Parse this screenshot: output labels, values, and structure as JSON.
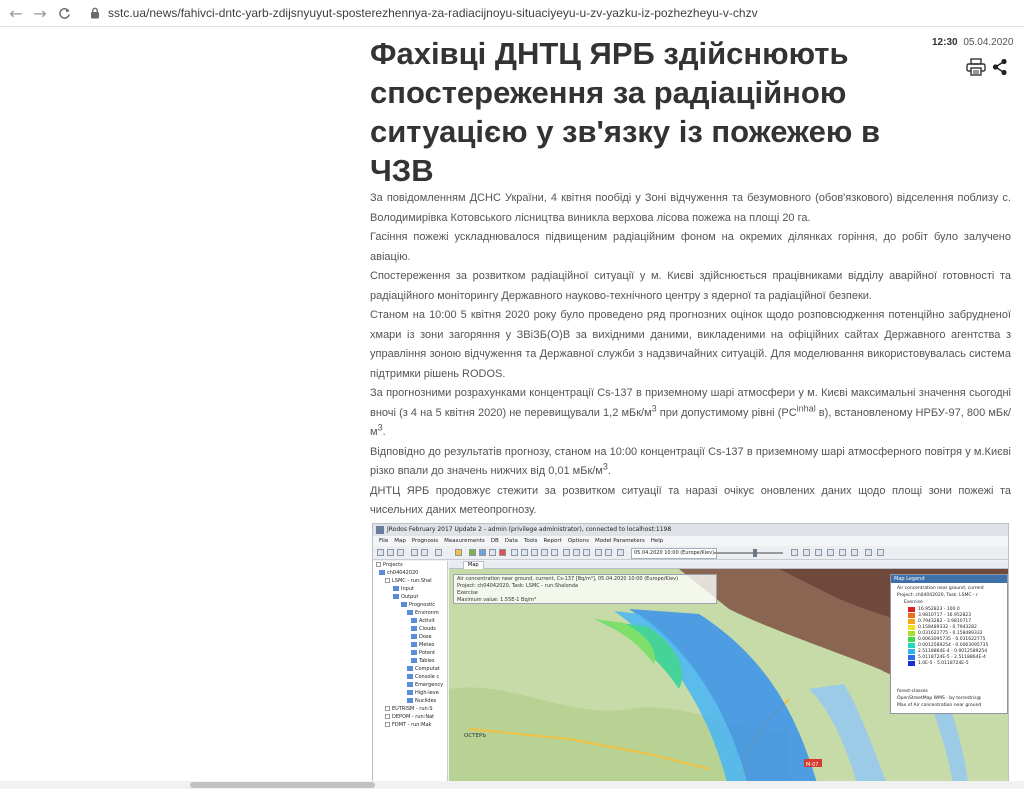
{
  "browser": {
    "url": "sstc.ua/news/fahivci-dntc-yarb-zdijsnyuyut-sposterezhennya-za-radiacijnoyu-situaciyeyu-u-zv-yazku-iz-pozhezheyu-v-chzv",
    "back_icon": "back-arrow-icon",
    "forward_icon": "forward-arrow-icon",
    "reload_icon": "reload-icon",
    "lock_icon": "lock-icon"
  },
  "article": {
    "title": "Фахівці ДНТЦ ЯРБ здійснюють спостереження за радіаційною ситуацією у зв'язку із пожежею в ЧЗВ",
    "time": "12:30",
    "date": "05.04.2020",
    "print_icon": "printer-icon",
    "share_icon": "share-icon",
    "paragraphs": {
      "p1": "За повідомленням ДСНС України, 4 квітня пообіді у Зоні відчуження та безумовного (обов'язкового) відселення поблизу с. Володимирівка Котовського лісництва виникла верхова лісова пожежа на площі 20 га.",
      "p2": "Гасіння пожежі ускладнювалося підвищеним радіаційним фоном на окремих ділянках горіння, до робіт було залучено авіацію.",
      "p3": "Спостереження за розвитком радіаційної ситуації у м. Києві здійснюється працівниками відділу аварійної готовності та радіаційного моніторингу Державного науково-технічного центру з ядерної та радіаційної безпеки.",
      "p4": "Станом на 10:00 5 квітня 2020 року було проведено ряд прогнозних оцінок щодо розповсюдження потенційно забрудненої хмари із зони загоряння у ЗВіЗБ(О)В за вихідними даними, викладеними на офіційних сайтах Державного агентства з управління зоною відчуження та Державної служби з надзвичайних ситуацій. Для моделювання використовувалась система підтримки рішень RODOS.",
      "p5a": "За прогнозними розрахунками концентрації Cs-137 в приземному шарі атмосфери у м. Києві максимальні значення сьогодні вночі (з 4 на 5 квітня 2020) не перевищували 1,2 мБк/м",
      "p5_sup1": "3",
      "p5b": " при допустимому рівні (PC",
      "p5_sup2": "inhal",
      "p5c": " в), встановленому НРБУ-97, 800 мБк/м",
      "p5_sup3": "3",
      "p5d": ".",
      "p6a": "Відповідно до результатів прогнозу, станом на 10:00 концентрації Cs-137 в приземному шарі атмосферного повітря у м.Києві різко впали до значень нижчих від 0,01 мБк/м",
      "p6_sup": "3",
      "p6b": ".",
      "p7": "ДНТЦ ЯРБ продовжує стежити за розвитком ситуації та наразі очікує оновлених даних щодо площі зони пожежі та чисельних даних метеопрогнозу."
    }
  },
  "rodos": {
    "window_title": "JRodos February 2017 Update 2 - admin (privilege administrator), connected to localhost:1198",
    "menu": [
      "File",
      "Map",
      "Prognosis",
      "Measurements",
      "DB",
      "Data",
      "Tools",
      "Report",
      "Options",
      "Model Parameters",
      "Help"
    ],
    "toolbar_date": "05.04.2020 10:00 (Europe/Kiev)",
    "map_tab": "Map",
    "tree": {
      "projects": "Projects",
      "project": "ch04042020",
      "lsmc": "LSMC - run:Shal",
      "input": "Input",
      "output": "Output",
      "prognosis": "Prognostic",
      "items": [
        "Environm",
        "Activit",
        "Clouds",
        "Dose",
        "Meteo",
        "Potent",
        "Tables"
      ],
      "computational": "Computat",
      "console": "Console c",
      "emergency": "Emergency",
      "highlevel": "High-leve",
      "nuclides": "Nuclides",
      "eutrism": "EUTRISM - run:S",
      "depom": "DEPOM - run:Nat",
      "fdmt": "FDMT - run:Mak"
    },
    "info": {
      "line1": "Air concentration near ground, current, Cs-137 [Bq/m³], 05.04.2020 10:00 (Europe/Kiev)",
      "line2": "Project: ch04042020, Task: LSMC - run:Shalonda",
      "line3": "Exercise",
      "line4": "Maximum value: 1.55E-1 Bq/m³"
    },
    "map_labels": {
      "road": "M-07",
      "town": "ОСТЕРЬ"
    },
    "legend": {
      "title": "Map Legend",
      "subtitle": "Air concentration near ground, current",
      "project": "Project: ch04042020, Task: LSMC - r",
      "exercise": "Exercise",
      "classes": [
        {
          "label": "16.952823 - 100.0",
          "color": "#e02020"
        },
        {
          "label": "3.9810717 - 16.952823",
          "color": "#f06a1a"
        },
        {
          "label": "0.7943282 - 3.9810717",
          "color": "#f4a51c"
        },
        {
          "label": "0.158489332 - 0.7943282",
          "color": "#f5dd22"
        },
        {
          "label": "0.031622775 - 0.158489332",
          "color": "#a6e02a"
        },
        {
          "label": "0.0063095735 - 0.031622775",
          "color": "#3fd94a"
        },
        {
          "label": "0.0012589254 - 0.0063095735",
          "color": "#22d8b8"
        },
        {
          "label": "2.5118864E-4 - 0.0012589254",
          "color": "#2bb5f0"
        },
        {
          "label": "5.0118724E-5 - 2.5118864E-4",
          "color": "#2a6ef0"
        },
        {
          "label": "1.0E-5 - 5.0118724E-5",
          "color": "#1a2fd8"
        }
      ],
      "layers": [
        "forest-classes",
        "OpenStreetMap WMS - by terrestris@",
        "Max of Air concentration near ground"
      ]
    }
  }
}
